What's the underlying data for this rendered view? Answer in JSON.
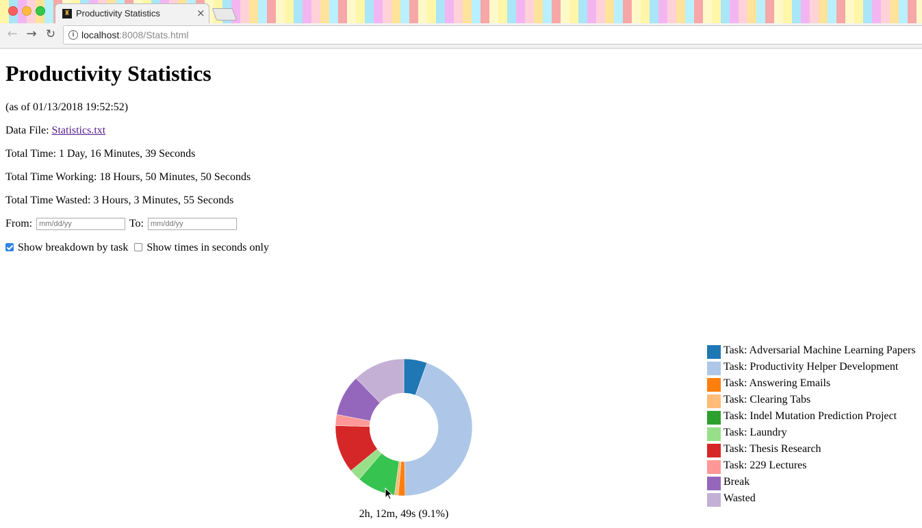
{
  "browser": {
    "tab_title": "Productivity Statistics",
    "tab_close": "×",
    "url_host": "localhost",
    "url_rest": ":8008/Stats.html",
    "icons": {
      "back": "arrow-left-icon",
      "forward": "arrow-right-icon",
      "reload": "reload-icon",
      "info": "info-icon",
      "close": "close-icon"
    }
  },
  "page": {
    "title": "Productivity Statistics",
    "as_of": "(as of 01/13/2018 19:52:52)",
    "data_file_label": "Data File: ",
    "data_file_link": "Statistics.txt",
    "total_time": "Total Time: 1 Day, 16 Minutes, 39 Seconds",
    "total_working": "Total Time Working: 18 Hours, 50 Minutes, 50 Seconds",
    "total_wasted": "Total Time Wasted: 3 Hours, 3 Minutes, 55 Seconds",
    "from_label": "From:",
    "to_label": "To:",
    "from_placeholder": "mm/dd/yy",
    "to_placeholder": "mm/dd/yy",
    "show_breakdown_label": "Show breakdown by task",
    "show_breakdown_checked": true,
    "show_seconds_label": "Show times in seconds only",
    "show_seconds_checked": false
  },
  "chart_caption": "2h, 12m, 49s (9.1%)",
  "chart_data": {
    "type": "pie",
    "donut": true,
    "legend_position": "right",
    "categories": [
      "Task: Adversarial Machine Learning Papers",
      "Task: Productivity Helper Development",
      "Task: Answering Emails",
      "Task: Clearing Tabs",
      "Task: Indel Mutation Prediction Project",
      "Task: Laundry",
      "Task: Thesis Research",
      "Task: 229 Lectures",
      "Break",
      "Wasted"
    ],
    "values": [
      5.5,
      44.2,
      1.6,
      0.9,
      9.1,
      2.8,
      11.3,
      2.6,
      9.7,
      12.3
    ],
    "colors": [
      "#1f77b4",
      "#aec7e8",
      "#ff7f0e",
      "#ffbb78",
      "#2ca02c",
      "#98df8a",
      "#d62728",
      "#ff9896",
      "#9467bd",
      "#c5b0d5"
    ],
    "highlighted_index": 4,
    "highlight_color": "#37c350"
  }
}
